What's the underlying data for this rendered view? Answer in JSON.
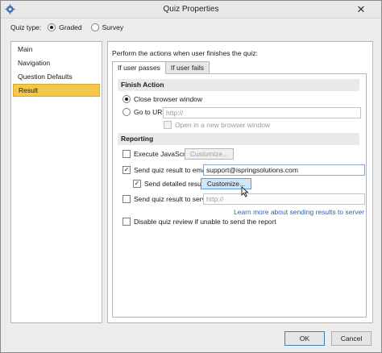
{
  "window": {
    "title": "Quiz Properties"
  },
  "quiz_type": {
    "label": "Quiz type:",
    "options": [
      {
        "label": "Graded",
        "selected": true
      },
      {
        "label": "Survey",
        "selected": false
      }
    ]
  },
  "sidebar": {
    "items": [
      {
        "label": "Main",
        "active": false
      },
      {
        "label": "Navigation",
        "active": false
      },
      {
        "label": "Question Defaults",
        "active": false
      },
      {
        "label": "Result",
        "active": true
      }
    ]
  },
  "content": {
    "intro": "Perform the actions when user finishes the quiz:",
    "tabs": [
      {
        "label": "If user passes",
        "active": true
      },
      {
        "label": "If user fails",
        "active": false
      }
    ],
    "finish_action": {
      "heading": "Finish Action",
      "close_browser": "Close browser window",
      "close_browser_selected": true,
      "goto_url": "Go to URL:",
      "goto_url_selected": false,
      "url_placeholder": "http://",
      "open_new_window": "Open in a new browser window"
    },
    "reporting": {
      "heading": "Reporting",
      "execute_js": "Execute JavaScript",
      "execute_js_checked": false,
      "customize_label": "Customize...",
      "send_email": "Send quiz result to email",
      "send_email_checked": true,
      "email_value": "support@ispringsolutions.com",
      "send_detailed": "Send detailed results",
      "send_detailed_checked": true,
      "send_server": "Send quiz result to server",
      "send_server_checked": false,
      "server_placeholder": "http://",
      "learn_more_link": "Learn more about sending results to server",
      "disable_review": "Disable quiz review if unable to send the report",
      "disable_review_checked": false
    }
  },
  "footer": {
    "ok_label": "OK",
    "cancel_label": "Cancel"
  }
}
